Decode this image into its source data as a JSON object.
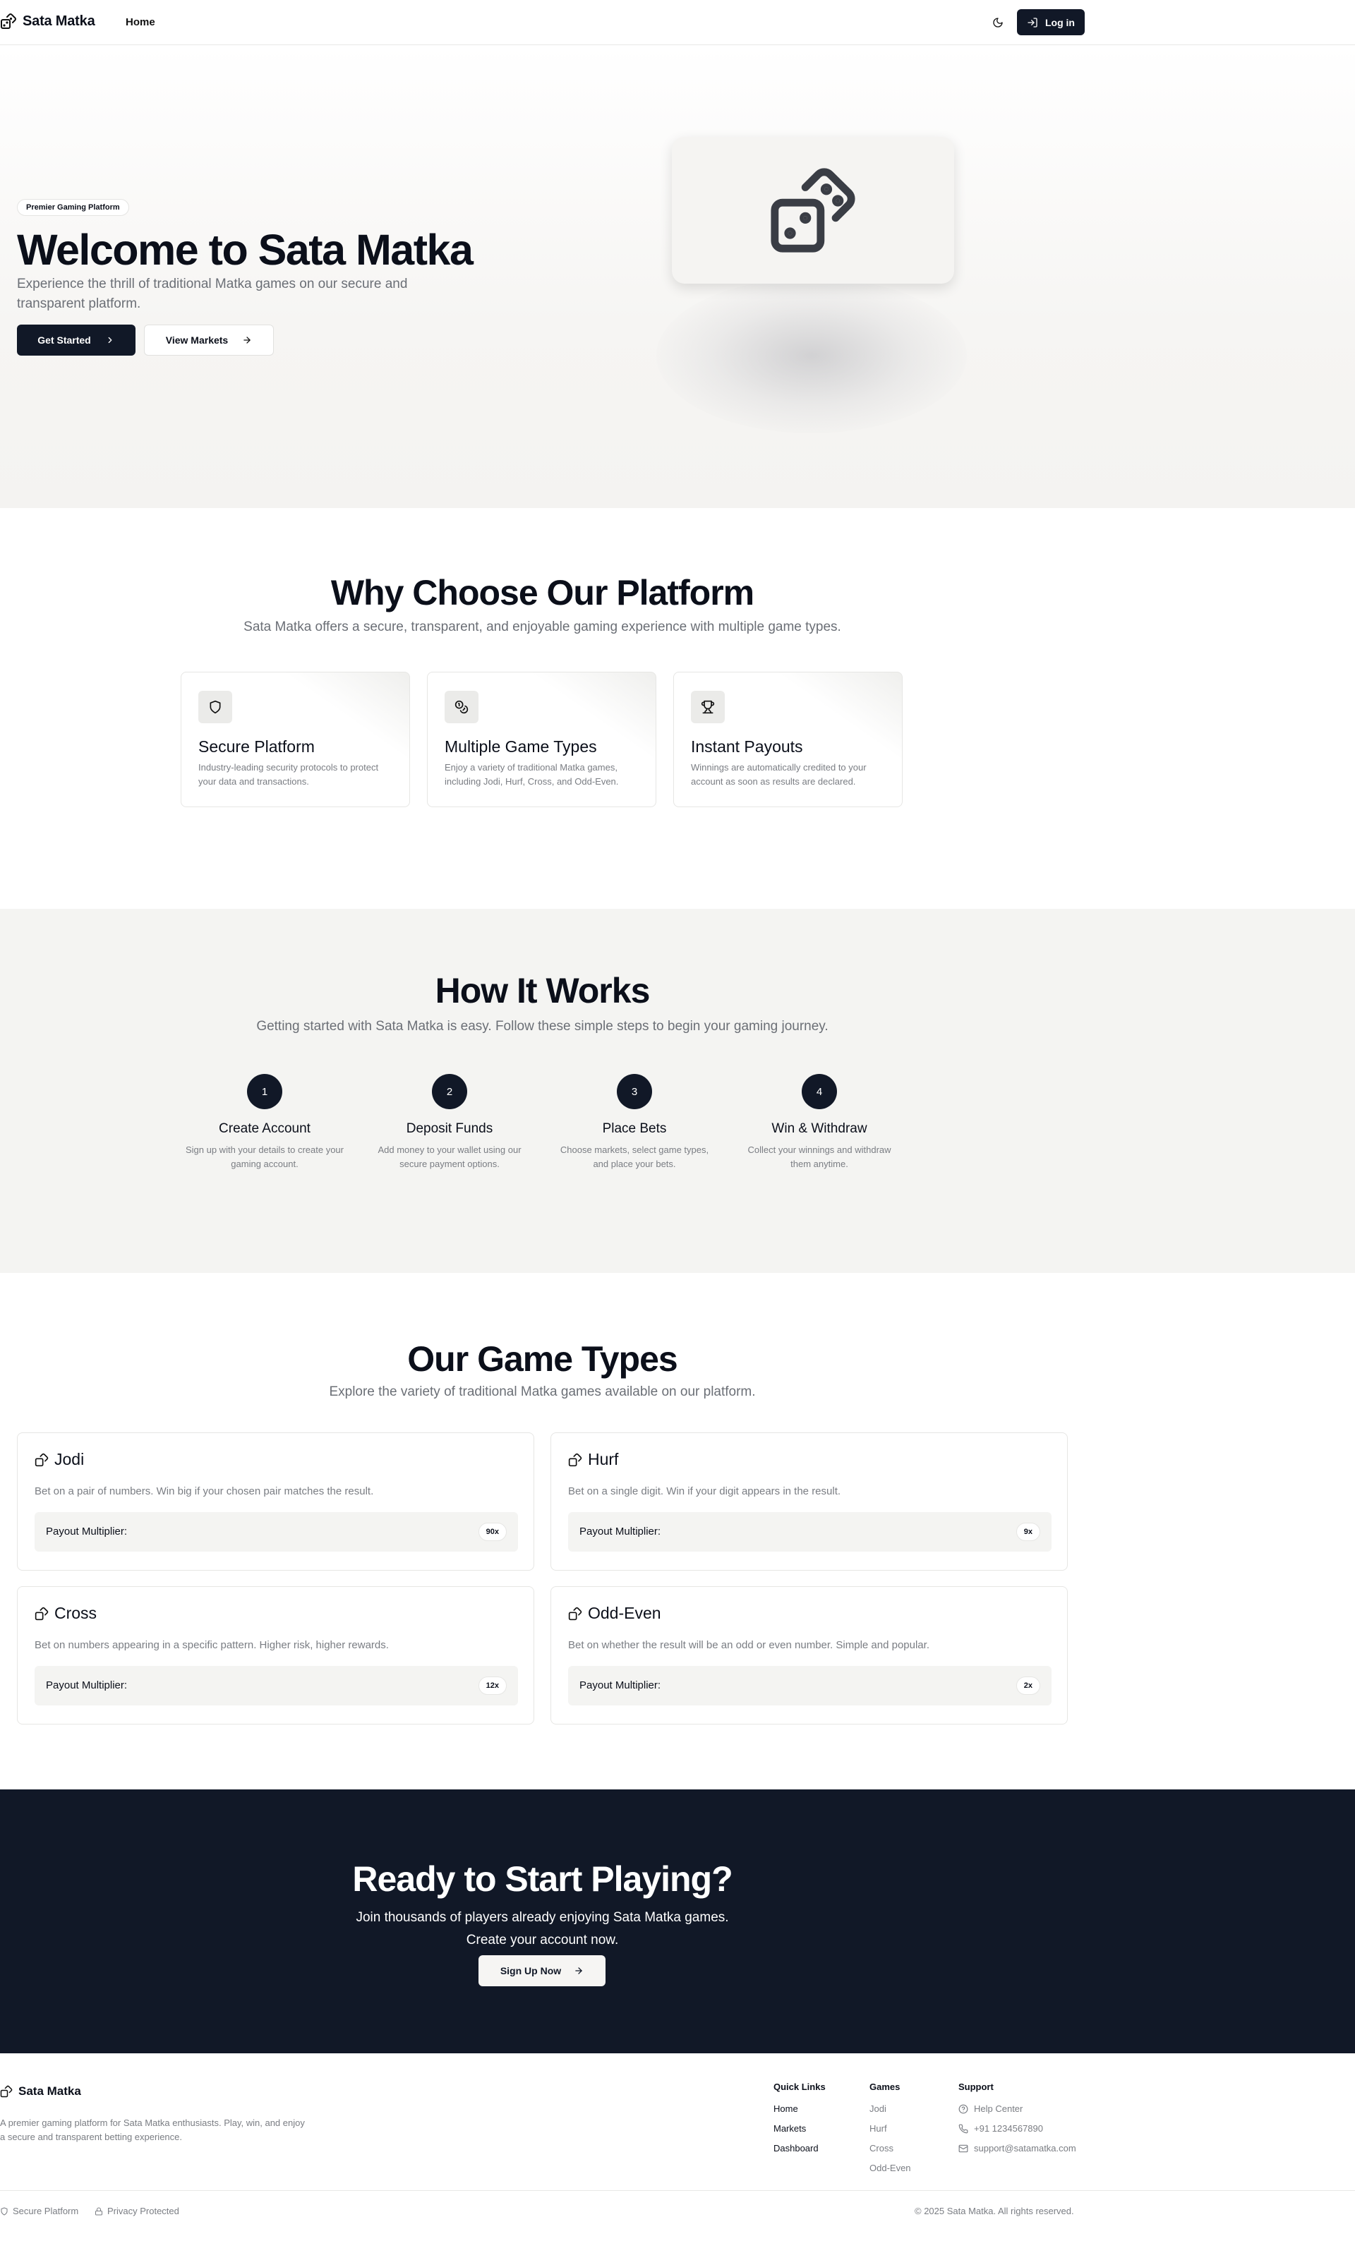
{
  "header": {
    "brand": "Sata Matka",
    "nav_home": "Home",
    "login_label": "Log in",
    "icons": {
      "logo": "dice-icon",
      "theme": "moon-icon",
      "login": "log-in-icon"
    }
  },
  "hero": {
    "badge": "Premier Gaming Platform",
    "title": "Welcome to Sata Matka",
    "subtitle": "Experience the thrill of traditional Matka games on our secure and transparent platform.",
    "primary_button": "Get Started",
    "secondary_button": "View Markets",
    "illustration_icon": "dices-icon"
  },
  "why": {
    "title": "Why Choose Our Platform",
    "subtitle": "Sata Matka offers a secure, transparent, and enjoyable gaming experience with multiple game types.",
    "features": [
      {
        "icon": "shield-icon",
        "title": "Secure Platform",
        "desc": "Industry-leading security protocols to protect your data and transactions."
      },
      {
        "icon": "coins-icon",
        "title": "Multiple Game Types",
        "desc": "Enjoy a variety of traditional Matka games, including Jodi, Hurf, Cross, and Odd-Even."
      },
      {
        "icon": "trophy-icon",
        "title": "Instant Payouts",
        "desc": "Winnings are automatically credited to your account as soon as results are declared."
      }
    ]
  },
  "how": {
    "title": "How It Works",
    "subtitle": "Getting started with Sata Matka is easy. Follow these simple steps to begin your gaming journey.",
    "steps": [
      {
        "num": "1",
        "title": "Create Account",
        "desc": "Sign up with your details to create your gaming account."
      },
      {
        "num": "2",
        "title": "Deposit Funds",
        "desc": "Add money to your wallet using our secure payment options."
      },
      {
        "num": "3",
        "title": "Place Bets",
        "desc": "Choose markets, select game types, and place your bets."
      },
      {
        "num": "4",
        "title": "Win & Withdraw",
        "desc": "Collect your winnings and withdraw them anytime."
      }
    ]
  },
  "games": {
    "title": "Our Game Types",
    "subtitle": "Explore the variety of traditional Matka games available on our platform.",
    "payout_label": "Payout Multiplier:",
    "items": [
      {
        "name": "Jodi",
        "desc": "Bet on a pair of numbers. Win big if your chosen pair matches the result.",
        "multiplier": "90x"
      },
      {
        "name": "Hurf",
        "desc": "Bet on a single digit. Win if your digit appears in the result.",
        "multiplier": "9x"
      },
      {
        "name": "Cross",
        "desc": "Bet on numbers appearing in a specific pattern. Higher risk, higher rewards.",
        "multiplier": "12x"
      },
      {
        "name": "Odd-Even",
        "desc": "Bet on whether the result will be an odd or even number. Simple and popular.",
        "multiplier": "2x"
      }
    ]
  },
  "cta": {
    "title": "Ready to Start Playing?",
    "line1": "Join thousands of players already enjoying Sata Matka games.",
    "line2": "Create your account now.",
    "button": "Sign Up Now"
  },
  "footer": {
    "brand": "Sata Matka",
    "desc": "A premier gaming platform for Sata Matka enthusiasts. Play, win, and enjoy a secure and transparent betting experience.",
    "quick_links": {
      "heading": "Quick Links",
      "items": [
        "Home",
        "Markets",
        "Dashboard"
      ]
    },
    "games": {
      "heading": "Games",
      "items": [
        "Jodi",
        "Hurf",
        "Cross",
        "Odd-Even"
      ]
    },
    "support": {
      "heading": "Support",
      "items": [
        {
          "icon": "help-circle-icon",
          "label": "Help Center"
        },
        {
          "icon": "phone-icon",
          "label": "+91 1234567890"
        },
        {
          "icon": "mail-icon",
          "label": "support@satamatka.com"
        }
      ]
    },
    "badges": [
      "Secure Platform",
      "Privacy Protected"
    ],
    "copyright": "© 2025 Sata Matka. All rights reserved."
  },
  "colors": {
    "primary": "#111827",
    "muted": "#7a7d83",
    "section_alt": "#f4f4f2"
  }
}
